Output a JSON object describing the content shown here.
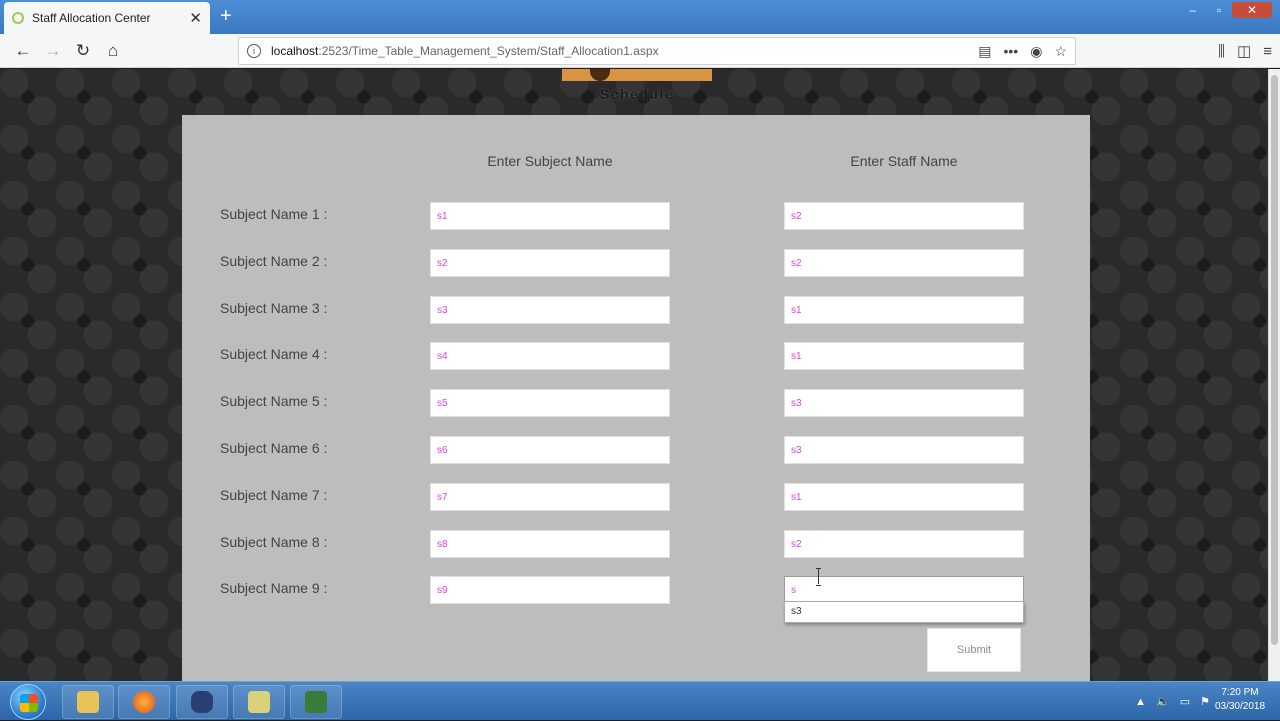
{
  "browser": {
    "tab_title": "Staff Allocation Center",
    "url_host": "localhost",
    "url_path": ":2523/Time_Table_Management_System/Staff_Allocation1.aspx"
  },
  "logo": {
    "text": "Schedule"
  },
  "form": {
    "subject_header": "Enter Subject Name",
    "staff_header": "Enter Staff Name",
    "rows": [
      {
        "label": "Subject Name 1 :",
        "subject": "s1",
        "staff": "s2"
      },
      {
        "label": "Subject Name 2 :",
        "subject": "s2",
        "staff": "s2"
      },
      {
        "label": "Subject Name 3 :",
        "subject": "s3",
        "staff": "s1"
      },
      {
        "label": "Subject Name 4 :",
        "subject": "s4",
        "staff": "s1"
      },
      {
        "label": "Subject Name 5 :",
        "subject": "s5",
        "staff": "s3"
      },
      {
        "label": "Subject Name 6 :",
        "subject": "s6",
        "staff": "s3"
      },
      {
        "label": "Subject Name 7 :",
        "subject": "s7",
        "staff": "s1"
      },
      {
        "label": "Subject Name 8 :",
        "subject": "s8",
        "staff": "s2"
      },
      {
        "label": "Subject Name 9 :",
        "subject": "s9",
        "staff": "s"
      }
    ],
    "autocomplete_suggestion": "s3",
    "submit_label": "Submit"
  },
  "taskbar": {
    "time": "7:20 PM",
    "date": "03/30/2018"
  },
  "colors": {
    "field_text": "#e040e0",
    "panel_bg": "#bdbdbd",
    "logo_accent": "#d89440"
  }
}
